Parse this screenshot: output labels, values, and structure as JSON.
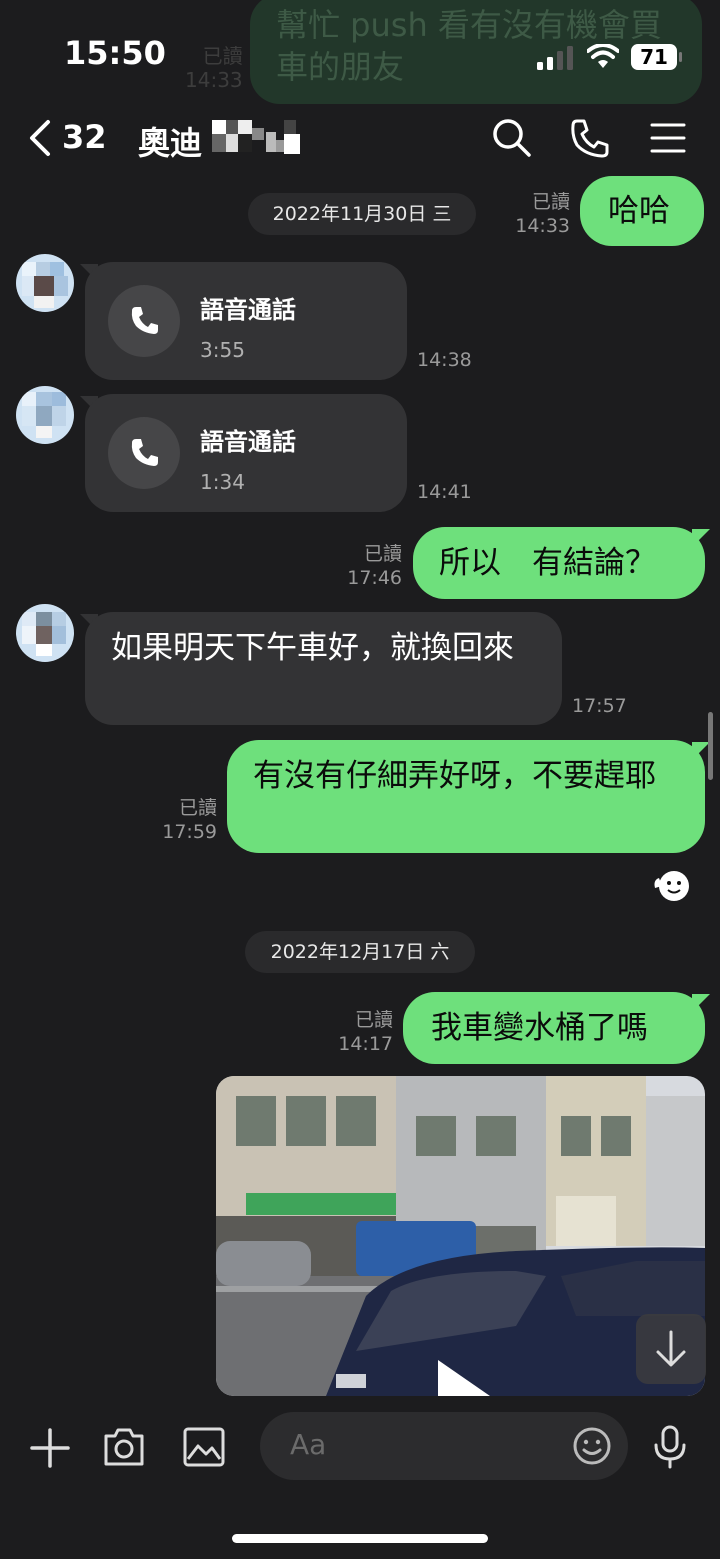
{
  "status_bar": {
    "time": "15:50",
    "battery": "71"
  },
  "previous_message": {
    "text": "幫忙 push 看有沒有機會買\n車的朋友",
    "read": "已讀",
    "time": "14:33"
  },
  "header": {
    "back_count": "32",
    "chat_name": "奧迪"
  },
  "messages": {
    "m1": {
      "text": "哈哈",
      "read": "已讀",
      "time": "14:33"
    },
    "date1": "2022年11月30日 三",
    "call1": {
      "title": "語音通話",
      "duration": "3:55",
      "time": "14:38"
    },
    "call2": {
      "title": "語音通話",
      "duration": "1:34",
      "time": "14:41"
    },
    "m2": {
      "text": "所以　有結論？",
      "read": "已讀",
      "time": "17:46"
    },
    "m3": {
      "text": "如果明天下午車好，就換回來",
      "time": "17:57"
    },
    "m4": {
      "text": "有沒有仔細弄好呀，不要趕耶",
      "read": "已讀",
      "time": "17:59"
    },
    "date2": "2022年12月17日 六",
    "m5": {
      "text": "我車變水桶了嗎",
      "read": "已讀",
      "time": "14:17"
    }
  },
  "composer": {
    "placeholder": "Aa"
  },
  "colors": {
    "outgoing_bubble": "#6ee07c",
    "incoming_bubble": "#333335",
    "background": "#1c1c1e"
  },
  "icons": [
    "back-chevron-icon",
    "search-icon",
    "phone-icon",
    "menu-icon",
    "call-icon",
    "sticker-reaction-icon",
    "plus-icon",
    "camera-icon",
    "image-icon",
    "emoji-icon",
    "microphone-icon",
    "scroll-down-icon",
    "play-icon"
  ]
}
